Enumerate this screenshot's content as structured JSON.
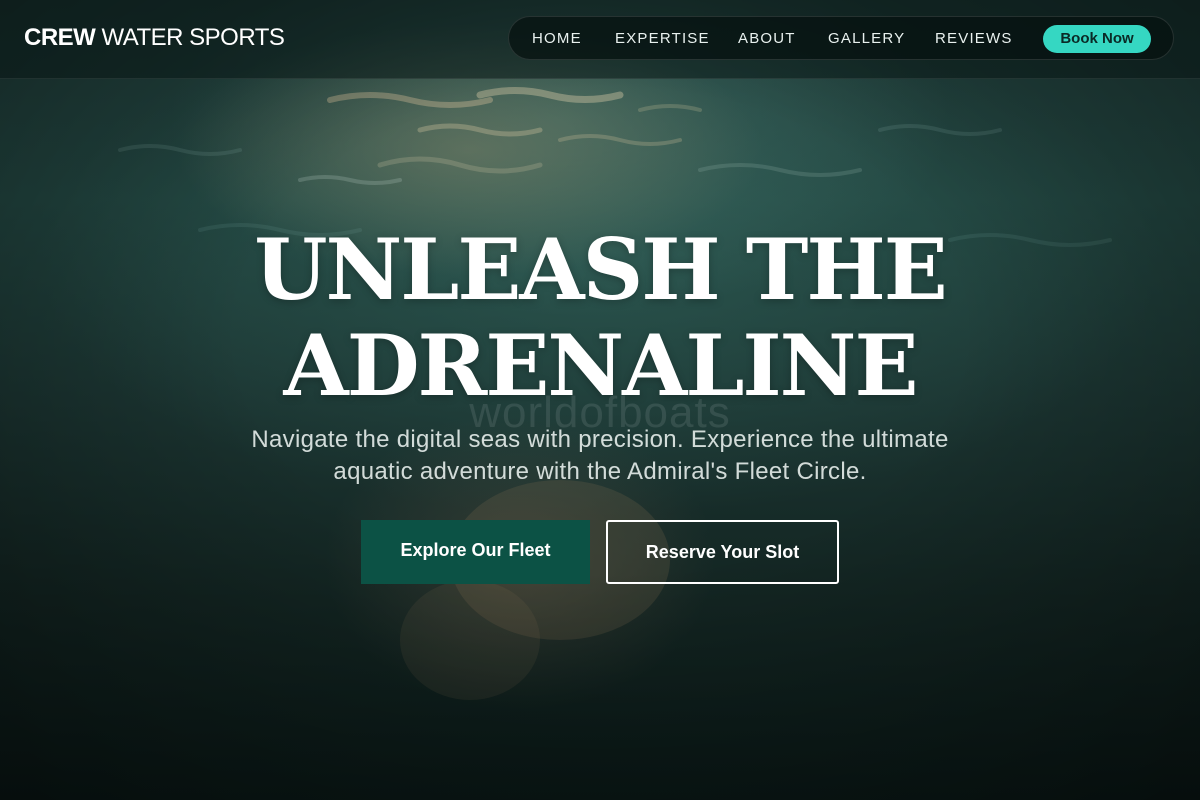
{
  "brand": {
    "bold": "CREW",
    "light": "WATER SPORTS"
  },
  "nav": {
    "items": [
      "HOME",
      "EXPERTISE",
      "ABOUT",
      "GALLERY",
      "REVIEWS"
    ],
    "cta": "Book Now"
  },
  "hero": {
    "headline_line1": "UNLEASH THE",
    "headline_line2": "ADRENALINE",
    "watermark": "worldofboats",
    "subtitle_line1": "Navigate the digital seas with precision. Experience the ultimate",
    "subtitle_line2": "aquatic adventure with the Admiral's Fleet Circle.",
    "primary_button": "Explore Our Fleet",
    "secondary_button": "Reserve Your Slot"
  },
  "colors": {
    "accent": "#35d7c2",
    "primary_button_bg": "#0c5245",
    "overlay_dark": "#0b1a18"
  }
}
